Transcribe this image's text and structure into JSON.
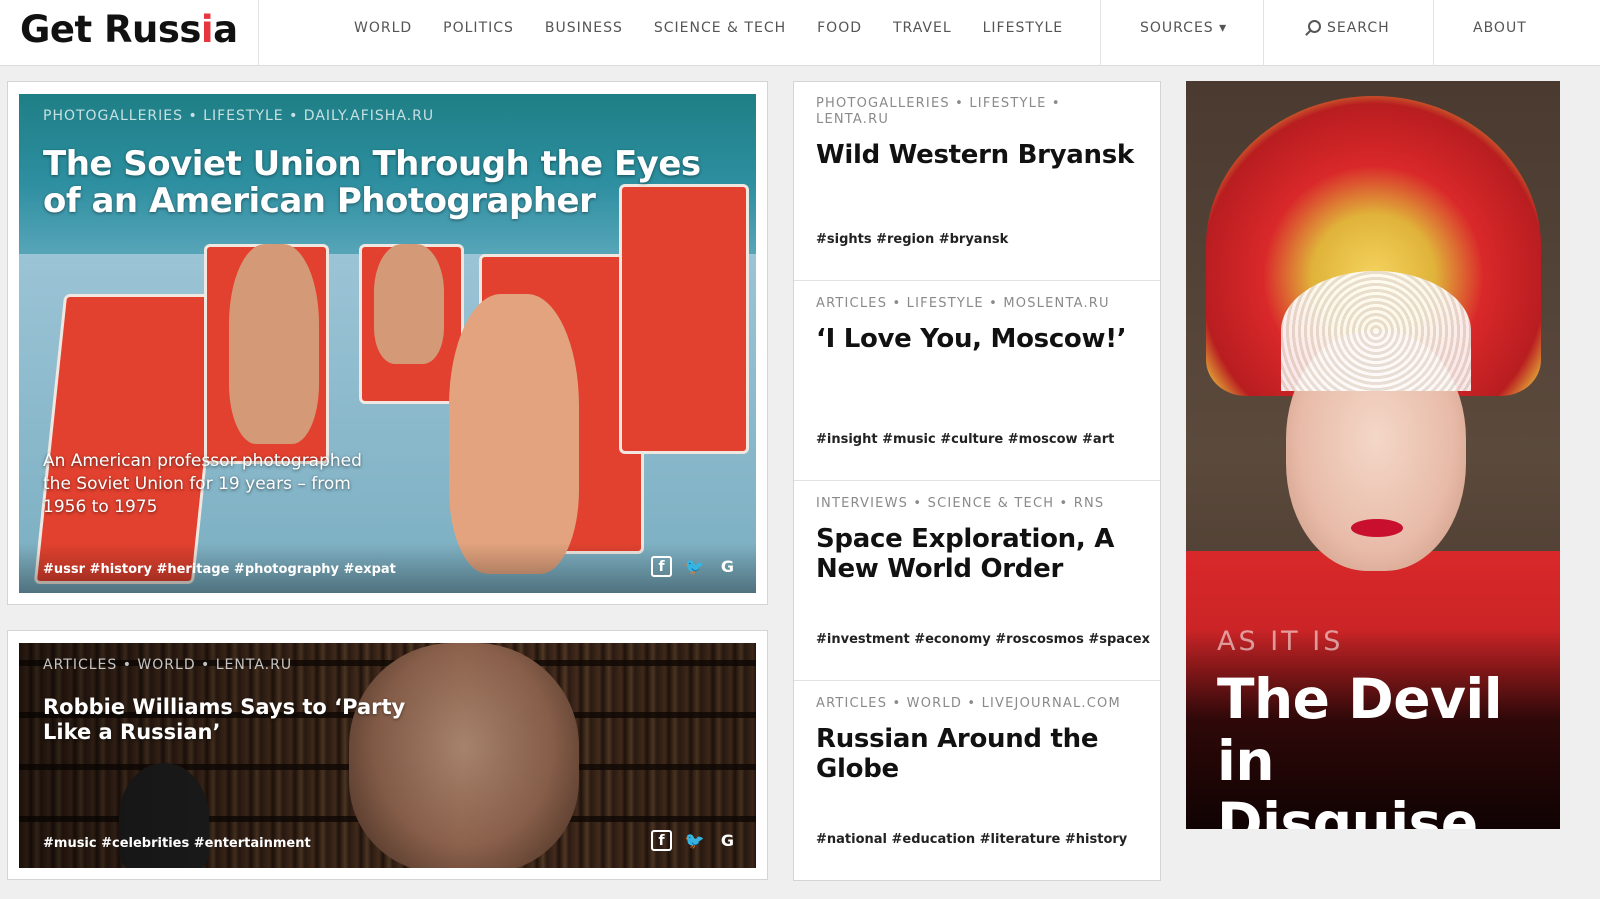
{
  "site": {
    "logo_main": "Get Russ",
    "logo_i": "i",
    "logo_end": "a"
  },
  "nav": {
    "items": [
      "WORLD",
      "POLITICS",
      "BUSINESS",
      "SCIENCE & TECH",
      "FOOD",
      "TRAVEL",
      "LIFESTYLE"
    ],
    "sources": "SOURCES ▾",
    "search": "SEARCH",
    "about": "ABOUT"
  },
  "hero": {
    "meta": "PHOTOGALLERIES • LIFESTYLE • DAILY.AFISHA.RU",
    "title": "The Soviet Union Through the Eyes of an American Photographer",
    "summary": "An American professor photographed the Soviet Union for 19 years – from 1956 to 1975",
    "tags": "#ussr #history #heritage #photography #expat"
  },
  "second": {
    "meta": "ARTICLES • WORLD • LENTA.RU",
    "title": "Robbie Williams Says to ‘Party Like a Russian’",
    "tags": "#music #celebrities #entertainment"
  },
  "list": [
    {
      "meta": "PHOTOGALLERIES • LIFESTYLE • LENTA.RU",
      "title": "Wild Western Bryansk",
      "tags": "#sights #region #bryansk"
    },
    {
      "meta": "ARTICLES • LIFESTYLE • MOSLENTA.RU",
      "title": "‘I Love You, Moscow!’",
      "tags": "#insight #music #culture #moscow #art"
    },
    {
      "meta": "INTERVIEWS • SCIENCE & TECH • RNS",
      "title": "Space Exploration, A New World Order",
      "tags": "#investment #economy #roscosmos #spacex"
    },
    {
      "meta": "ARTICLES • WORLD • LIVEJOURNAL.COM",
      "title": "Russian Around the Globe",
      "tags": "#national #education #literature #history"
    }
  ],
  "feature": {
    "kicker": "AS IT IS",
    "title": "The Devil in Disguise"
  },
  "social": {
    "fb": "f",
    "tw": "🐦",
    "g": "G"
  }
}
